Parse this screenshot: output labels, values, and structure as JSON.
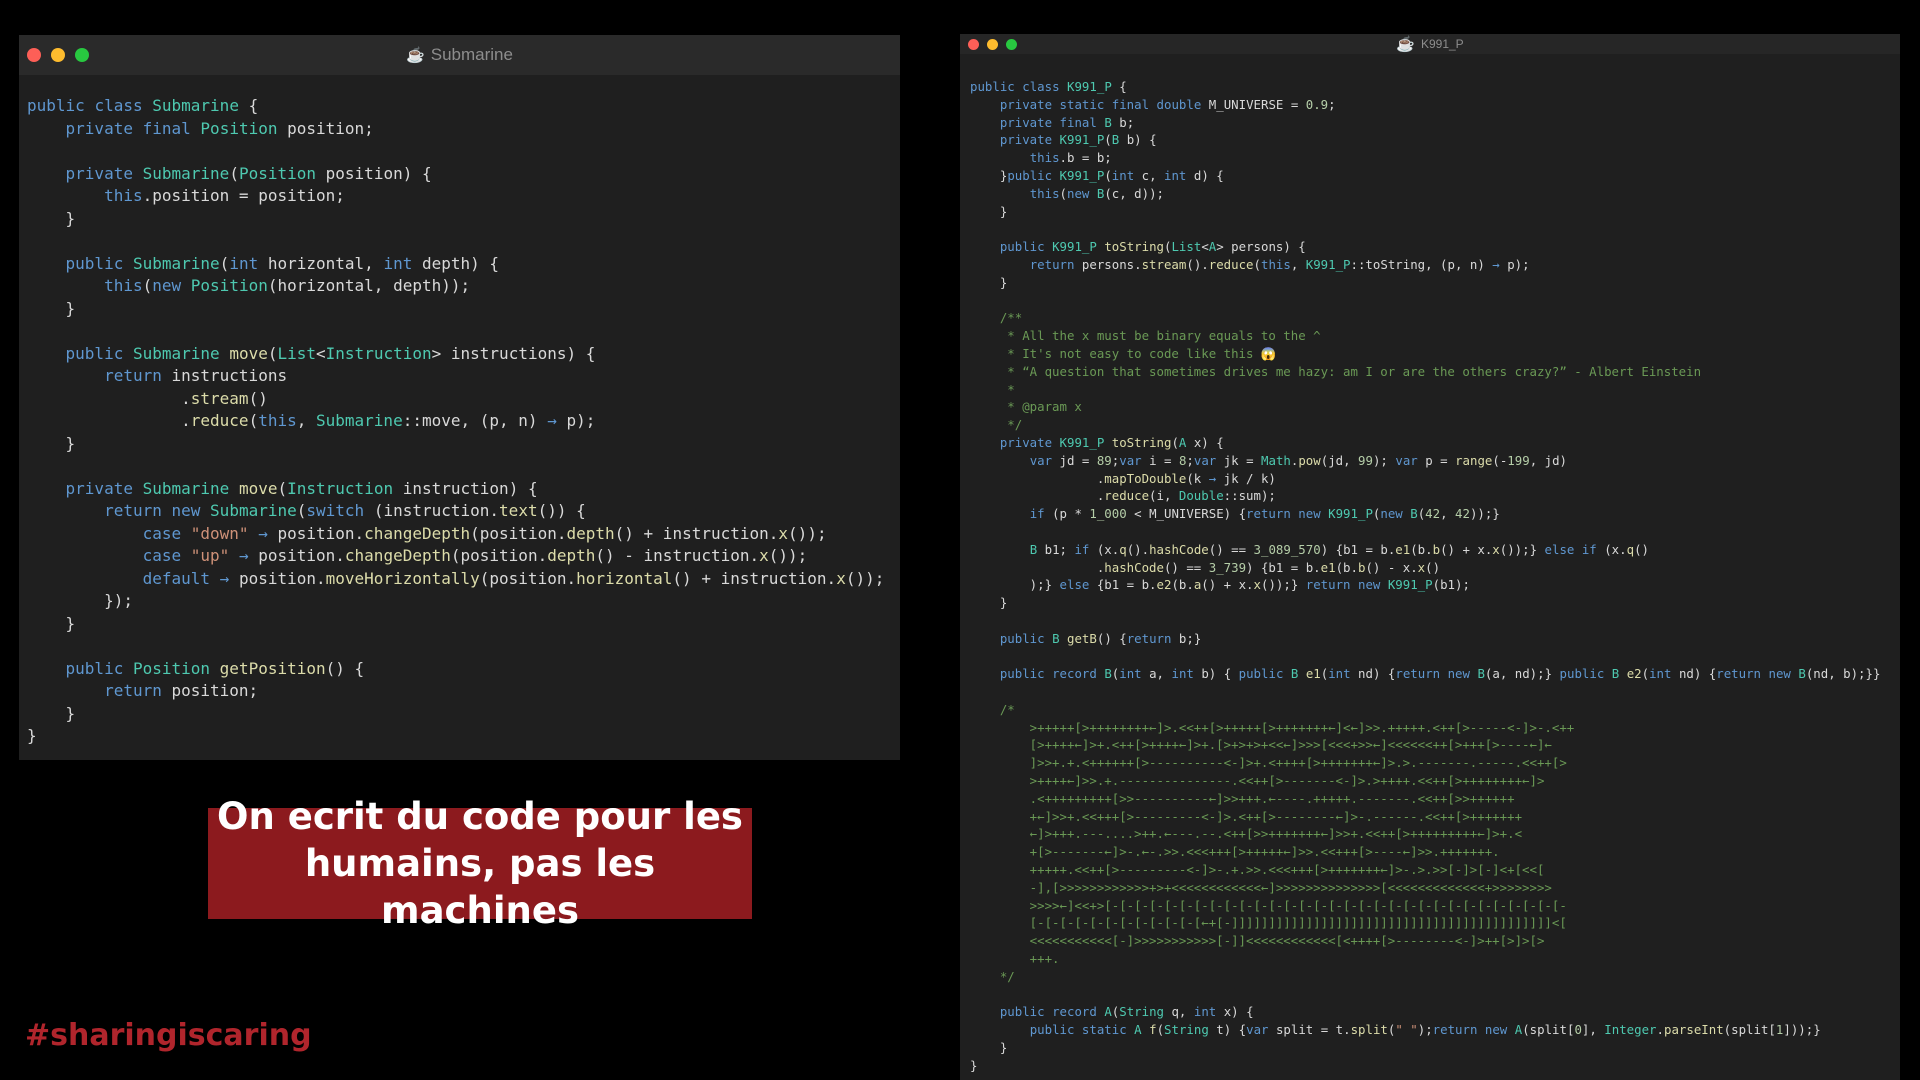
{
  "colors": {
    "close": "#fd5f57",
    "minimize": "#febc2e",
    "maximize": "#28c840",
    "banner_bg": "#8c1a1e",
    "hashtag": "#b0252c"
  },
  "left_window": {
    "title": "Submarine",
    "icon": "java-icon",
    "code_lines": [
      "public class Submarine {",
      "    private final Position position;",
      "",
      "    private Submarine(Position position) {",
      "        this.position = position;",
      "    }",
      "",
      "    public Submarine(int horizontal, int depth) {",
      "        this(new Position(horizontal, depth));",
      "    }",
      "",
      "    public Submarine move(List<Instruction> instructions) {",
      "        return instructions",
      "                .stream()",
      "                .reduce(this, Submarine::move, (p, n) → p);",
      "    }",
      "",
      "    private Submarine move(Instruction instruction) {",
      "        return new Submarine(switch (instruction.text()) {",
      "            case \"down\" → position.changeDepth(position.depth() + instruction.x());",
      "            case \"up\" → position.changeDepth(position.depth() - instruction.x());",
      "            default → position.moveHorizontally(position.horizontal() + instruction.x());",
      "        });",
      "    }",
      "",
      "    public Position getPosition() {",
      "        return position;",
      "    }",
      "}"
    ]
  },
  "right_window": {
    "title": "K991_P",
    "icon": "java-icon",
    "code_lines": [
      "public class K991_P {",
      "    private static final double M_UNIVERSE = 0.9;",
      "    private final B b;",
      "    private K991_P(B b) {",
      "        this.b = b;",
      "    }public K991_P(int c, int d) {",
      "        this(new B(c, d));",
      "    }",
      "",
      "    public K991_P toString(List<A> persons) {",
      "        return persons.stream().reduce(this, K991_P::toString, (p, n) → p);",
      "    }",
      "",
      "    /**",
      "     * All the x must be binary equals to the ^",
      "     * It's not easy to code like this 😱",
      "     * “A question that sometimes drives me hazy: am I or are the others crazy?” - Albert Einstein",
      "     *",
      "     * @param x",
      "     */",
      "    private K991_P toString(A x) {",
      "        var jd = 89;var i = 8;var jk = Math.pow(jd, 99); var p = range(-199, jd)",
      "                 .mapToDouble(k → jk / k)",
      "                 .reduce(i, Double::sum);",
      "        if (p * 1_000 < M_UNIVERSE) {return new K991_P(new B(42, 42));}",
      "",
      "        B b1; if (x.q().hashCode() == 3_089_570) {b1 = b.e1(b.b() + x.x());} else if (x.q()",
      "                 .hashCode() == 3_739) {b1 = b.e1(b.b() - x.x()",
      "        );} else {b1 = b.e2(b.a() + x.x());} return new K991_P(b1);",
      "    }",
      "",
      "    public B getB() {return b;}",
      "",
      "    public record B(int a, int b) { public B e1(int nd) {return new B(a, nd);} public B e2(int nd) {return new B(nd, b);}}",
      "",
      "    /*",
      "        >+++++[>++++++++←]>.<<++[>+++++[>+++++++←]<←]>>.+++++.<++[>-----<-]>-.<++",
      "        [>++++←]>+.<++[>++++←]>+.[>+>+>+<<←]>>>[<<<+>>←]<<<<<<++[>+++[>----←]←",
      "        ]>>+.+.<++++++[>----------<-]>+.<++++[>+++++++←]>.>.-------.-----.<<++[>",
      "        >++++←]>>.+.---------------.<<++[>-------<-]>.>++++.<<++[>++++++++←]>",
      "        .<+++++++++[>>----------←]>>+++.←----.+++++.-------.<<++[>>++++++",
      "        +←]>>+.<<+++[>---------<-]>.<++[>--------←]>-.------.<<++[>+++++++",
      "        ←]>+++.---....>++.←---.--.<++[>>+++++++←]>>+.<<++[>+++++++++←]>+.<",
      "        +[>-------←]>-.←-.>>.<<<+++[>+++++←]>>.<<+++[>----←]>>.+++++++.",
      "        +++++.<<++[>---------<-]>-.+.>>.<<<+++[>+++++++←]>-.>.>>[-]>[-]<+[<<[",
      "        -],[>>>>>>>>>>>>+>+<<<<<<<<<<<<←]>>>>>>>>>>>>>>[<<<<<<<<<<<<<+>>>>>>>>",
      "        >>>>←]<<+>[-[-[-[-[-[-[-[-[-[-[-[-[-[-[-[-[-[-[-[-[-[-[-[-[-[-[-[-[-[-[-",
      "        [-[-[-[-[-[-[-[-[-[-[-[←+[-]]]]]]]]]]]]]]]]]]]]]]]]]]]]]]]]]]]]]]]]]]]<[",
      "        <<<<<<<<<<<[-]>>>>>>>>>>>[-]]<<<<<<<<<<<<[<++++[>--------<-]>++[>]>[>",
      "        +++.",
      "    */",
      "",
      "    public record A(String q, int x) {",
      "        public static A f(String t) {var split = t.split(\" \");return new A(split[0], Integer.parseInt(split[1]));}",
      "    }",
      "}"
    ]
  },
  "banner": {
    "line1": "On ecrit du code pour les",
    "line2": "humains, pas les machines"
  },
  "hashtag": "#sharingiscaring"
}
